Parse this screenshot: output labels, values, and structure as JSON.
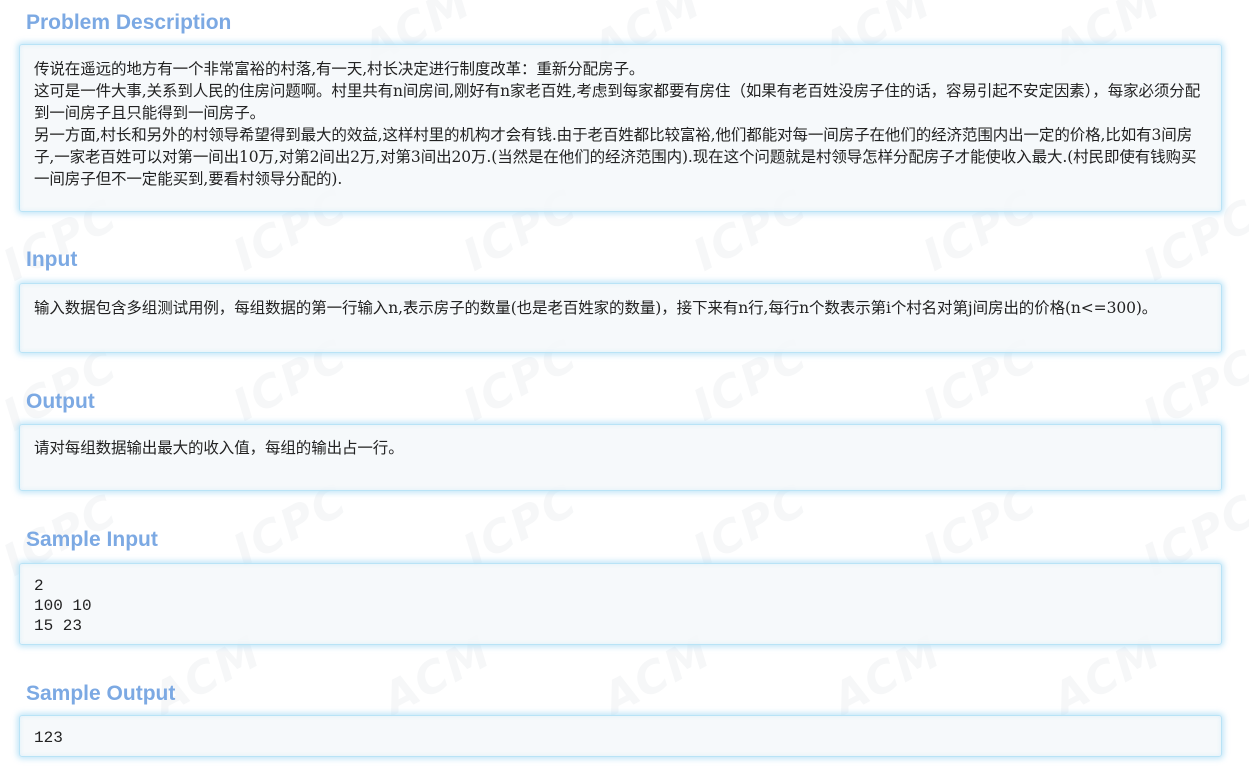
{
  "sections": {
    "description": {
      "title": "Problem Description",
      "paragraphs": [
        "传说在遥远的地方有一个非常富裕的村落,有一天,村长决定进行制度改革：重新分配房子。",
        "这可是一件大事,关系到人民的住房问题啊。村里共有n间房间,刚好有n家老百姓,考虑到每家都要有房住（如果有老百姓没房子住的话，容易引起不安定因素），每家必须分配到一间房子且只能得到一间房子。",
        "另一方面,村长和另外的村领导希望得到最大的效益,这样村里的机构才会有钱.由于老百姓都比较富裕,他们都能对每一间房子在他们的经济范围内出一定的价格,比如有3间房子,一家老百姓可以对第一间出10万,对第2间出2万,对第3间出20万.(当然是在他们的经济范围内).现在这个问题就是村领导怎样分配房子才能使收入最大.(村民即使有钱购买一间房子但不一定能买到,要看村领导分配的)."
      ]
    },
    "input": {
      "title": "Input",
      "text": "输入数据包含多组测试用例，每组数据的第一行输入n,表示房子的数量(也是老百姓家的数量)，接下来有n行,每行n个数表示第i个村名对第j间房出的价格(n<=300)。"
    },
    "output": {
      "title": "Output",
      "text": "请对每组数据输出最大的收入值，每组的输出占一行。"
    },
    "sample_input": {
      "title": "Sample Input",
      "text": "2\n100 10\n15 23"
    },
    "sample_output": {
      "title": "Sample Output",
      "text": "123"
    }
  },
  "watermark": {
    "text_a": "ACM",
    "text_b": "ICPC"
  },
  "colors": {
    "title": "#7ca9e3",
    "panel_border": "#b9e3f6",
    "panel_bg": "#f4f8fa",
    "text": "#222222"
  }
}
